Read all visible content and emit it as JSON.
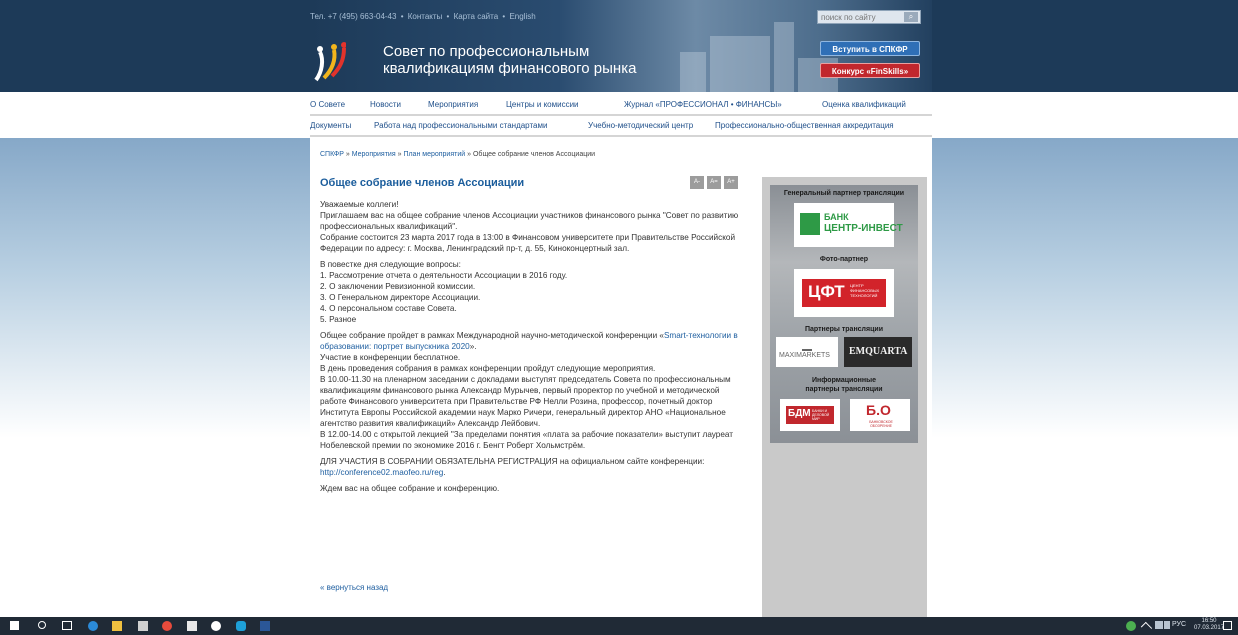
{
  "header": {
    "top_links": [
      "Тел. +7 (495) 663-04-43",
      "•",
      "Контакты",
      "•",
      "Карта сайта",
      "•",
      "English"
    ],
    "search_placeholder": "поиск по сайту",
    "search_icon": "magnifier-icon",
    "site_title_line1": "Совет по профессиональным",
    "site_title_line2": "квалификациям финансового рынка",
    "join_button": "Вступить в СПКФР",
    "contest_button": "Конкурс «FinSkills»"
  },
  "nav_primary": [
    "О Совете",
    "Новости",
    "Мероприятия",
    "Центры и комиссии",
    "Журнал «ПРОФЕССИОНАЛ • ФИНАНСЫ»",
    "Оценка квалификаций"
  ],
  "nav_secondary": [
    "Документы",
    "Работа над профессиональными стандартами",
    "Учебно-методический центр",
    "Профессионально-общественная аккредитация"
  ],
  "breadcrumb": [
    "СПКФР",
    "»",
    "Мероприятия",
    "»",
    "План мероприятий",
    "»",
    "Общее собрание членов Ассоциации"
  ],
  "article": {
    "title": "Общее собрание членов Ассоциации",
    "font_buttons": [
      "A-",
      "A=",
      "A+"
    ],
    "intro": "Уважаемые коллеги!",
    "invite": "Приглашаем вас на общее собрание членов Ассоциации участников финансового рынка \"Совет по развитию профессиональных квалификаций\".",
    "venue": "Собрание состоится 23 марта 2017 года в 13:00 в Финансовом университете при Правительстве Российской Федерации по адресу: г. Москва, Ленинградский пр-т, д. 55, Киноконцертный зал.",
    "agenda_title": "В повестке дня следующие вопросы:",
    "agenda": [
      "1. Рассмотрение отчета о деятельности Ассоциации в 2016 году.",
      "2. О заключении Ревизионной комиссии.",
      "3. О Генеральном директоре Ассоциации.",
      "4. О персональном составе Совета.",
      "5. Разное"
    ],
    "conf_prefix": "Общее собрание пройдет в рамках Международной научно-методической конференции «",
    "conf_link": "Smart-технологии в образовании: портрет выпускника 2020",
    "conf_suffix": "».",
    "free": "Участие в конференции бесплатное.",
    "events_intro": "В день проведения собрания в рамках конференции пройдут следующие мероприятия.",
    "plenary": "В 10.00-11.30 на пленарном заседании с докладами выступят председатель Совета по профессиональным квалификациям финансового рынка Александр Мурычев, первый проректор по учебной и методической работе Финансового университета при Правительстве РФ Нелли Розина, профессор, почетный доктор Института Европы Российской академии наук Марко Ричери, генеральный директор АНО «Национальное агентство развития квалификаций» Александр Лейбович.",
    "lecture": "В 12.00-14.00 с открытой лекцией \"За пределами понятия «плата за рабочие показатели» выступит лауреат Нобелевской премии по экономике 2016 г. Бенгт Роберт Хольмстрём.",
    "reg_prefix": "ДЛЯ УЧАСТИЯ В СОБРАНИИ ОБЯЗАТЕЛЬНА РЕГИСТРАЦИЯ на официальном сайте конференции: ",
    "reg_link": "http://conference02.maofeo.ru/reg",
    "reg_suffix": ".",
    "closing": "Ждем вас на общее собрание и конференцию.",
    "back_link": "« вернуться назад"
  },
  "sidebar": {
    "general_partner_label": "Генеральный партнер трансляции",
    "bank_logo_line1": "БАНК",
    "bank_logo_line2": "ЦЕНТР-ИНВЕСТ",
    "photo_partner_label": "Фото-партнер",
    "cft_logo": "ЦФТ",
    "cft_sub": "ЦЕНТР ФИНАНСОВЫХ ТЕХНОЛОГИЙ",
    "partners_label": "Партнеры трансляции",
    "maxi_logo": "MAXIMARKETS",
    "emq_logo": "EMQUARTA",
    "info_partners_label_line1": "Информационные",
    "info_partners_label_line2": "партнеры трансляции",
    "bdm_logo": "БДМ",
    "bdm_sub": "БАНКИ И ДЕЛОВОЙ МИР",
    "bo_logo": "Б.О",
    "bo_sub": "БАНКОВСКОЕ ОБОЗРЕНИЕ"
  },
  "taskbar": {
    "lang": "РУС",
    "time": "16:50",
    "date": "07.03.2017"
  }
}
